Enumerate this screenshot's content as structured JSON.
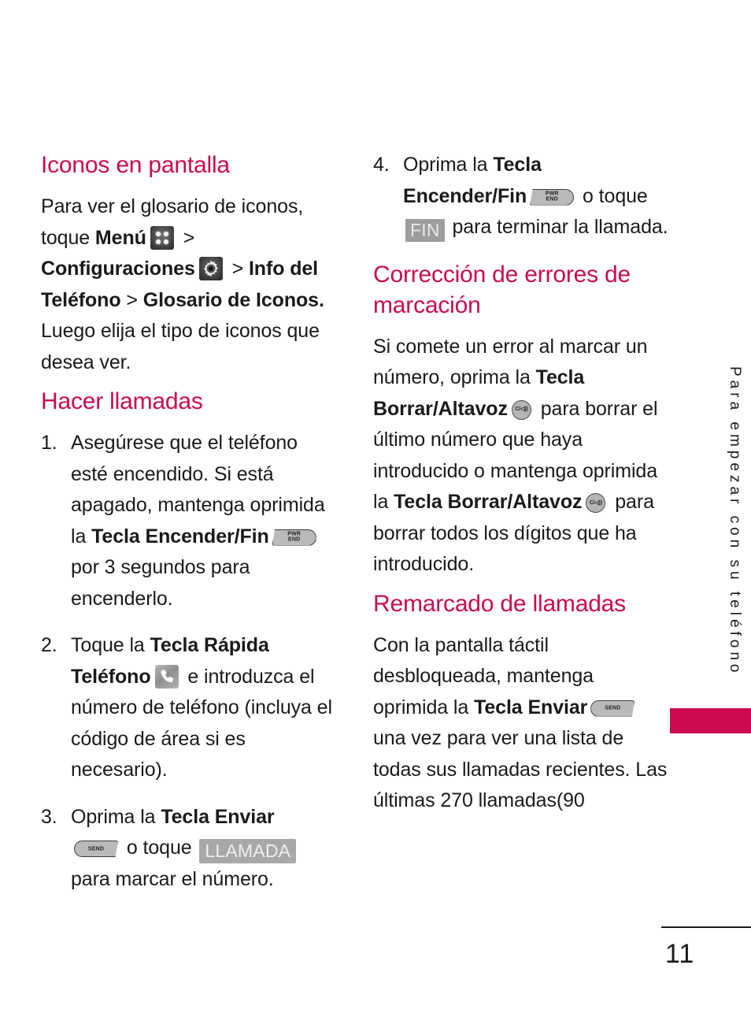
{
  "meta": {
    "page_number": "11",
    "side_tab_label": "Para empezar con su teléfono",
    "accent_color": "#cc0a50"
  },
  "left_column": {
    "section1": {
      "title": "Iconos en pantalla",
      "paragraph": {
        "t1": "Para ver el glosario de iconos, toque ",
        "b1": "Menú",
        "icon1": "menu-grid-icon",
        "t2": " > ",
        "b2": "Configuraciones",
        "icon2": "gear-icon",
        "t3": " > ",
        "b3": "Info del Teléfono",
        "t4": " > ",
        "b4": "Glosario de Iconos.",
        "t5": " Luego elija el tipo de iconos que desea ver."
      }
    },
    "section2": {
      "title": "Hacer llamadas",
      "steps": [
        {
          "num": "1.",
          "t1": "Asegúrese que el teléfono esté encendido. Si está apagado, mantenga oprimida la ",
          "b1": "Tecla Encender/Fin",
          "key1_line1": "PWR",
          "key1_line2": "END",
          "t2": " por 3 segundos para encenderlo."
        },
        {
          "num": "2.",
          "t1": "Toque la ",
          "b1": "Tecla Rápida Teléfono",
          "icon1": "phone-handset-icon",
          "t2": " e introduzca el número de teléfono (incluya el código de área si es necesario)."
        },
        {
          "num": "3.",
          "t1": "Oprima la ",
          "b1": "Tecla Enviar",
          "key1": "SEND",
          "t2": " o toque ",
          "softkey1": "LLAMADA",
          "t3": " para marcar el número."
        }
      ]
    }
  },
  "right_column": {
    "step4": {
      "num": "4.",
      "t1": "Oprima la ",
      "b1": "Tecla Encender/Fin",
      "key1_line1": "PWR",
      "key1_line2": "END",
      "t2": " o toque ",
      "softkey1": "FIN",
      "t3": " para terminar la llamada."
    },
    "section3": {
      "title": "Corrección de errores de marcación",
      "paragraph": {
        "t1": "Si comete un error al marcar un número, oprima la ",
        "b1": "Tecla Borrar/Altavoz",
        "key1": "C/◁))",
        "t2": " para borrar el último número que haya introducido o mantenga oprimida la ",
        "b2": "Tecla Borrar/Altavoz",
        "key2": "C/◁))",
        "t3": " para borrar todos los dígitos que ha introducido."
      }
    },
    "section4": {
      "title": "Remarcado de llamadas",
      "paragraph": {
        "t1": "Con la pantalla táctil desbloqueada, mantenga oprimida la ",
        "b1": "Tecla Enviar",
        "key1": "SEND",
        "t2": " una vez para ver una lista de todas sus llamadas recientes. Las últimas 270 llamadas(90"
      }
    }
  }
}
